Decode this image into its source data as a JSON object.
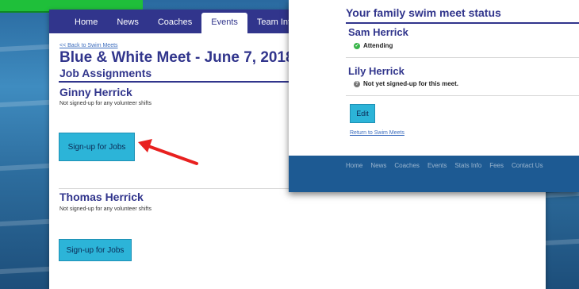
{
  "nav": {
    "items": [
      "Home",
      "News",
      "Coaches",
      "Events",
      "Team Info"
    ],
    "active": "Events"
  },
  "page": {
    "back_link": "<< Back to Swim Meets",
    "meet_title": "Blue & White Meet - June 7, 2018",
    "section_title": "Job Assignments"
  },
  "volunteers": [
    {
      "name": "Ginny Herrick",
      "status": "Not signed-up for any volunteer shifts",
      "button": "Sign-up for Jobs"
    },
    {
      "name": "Thomas Herrick",
      "status": "Not signed-up for any volunteer shifts",
      "button": "Sign-up for Jobs"
    }
  ],
  "family_status": {
    "title": "Your family swim meet status",
    "members": [
      {
        "name": "Sam Herrick",
        "status": "Attending",
        "icon": "check-circle-icon"
      },
      {
        "name": "Lily Herrick",
        "status": "Not yet signed-up for this meet.",
        "icon": "question-circle-icon"
      }
    ],
    "edit_button": "Edit",
    "return_link": "Return to Swim Meets"
  },
  "footer_nav": [
    "Home",
    "News",
    "Coaches",
    "Events",
    "Stats Info",
    "Fees",
    "Contact Us"
  ],
  "colors": {
    "navy": "#31358c",
    "button": "#2cb4d8",
    "accent_green": "#1fbf3a",
    "arrow": "#e8201f"
  }
}
